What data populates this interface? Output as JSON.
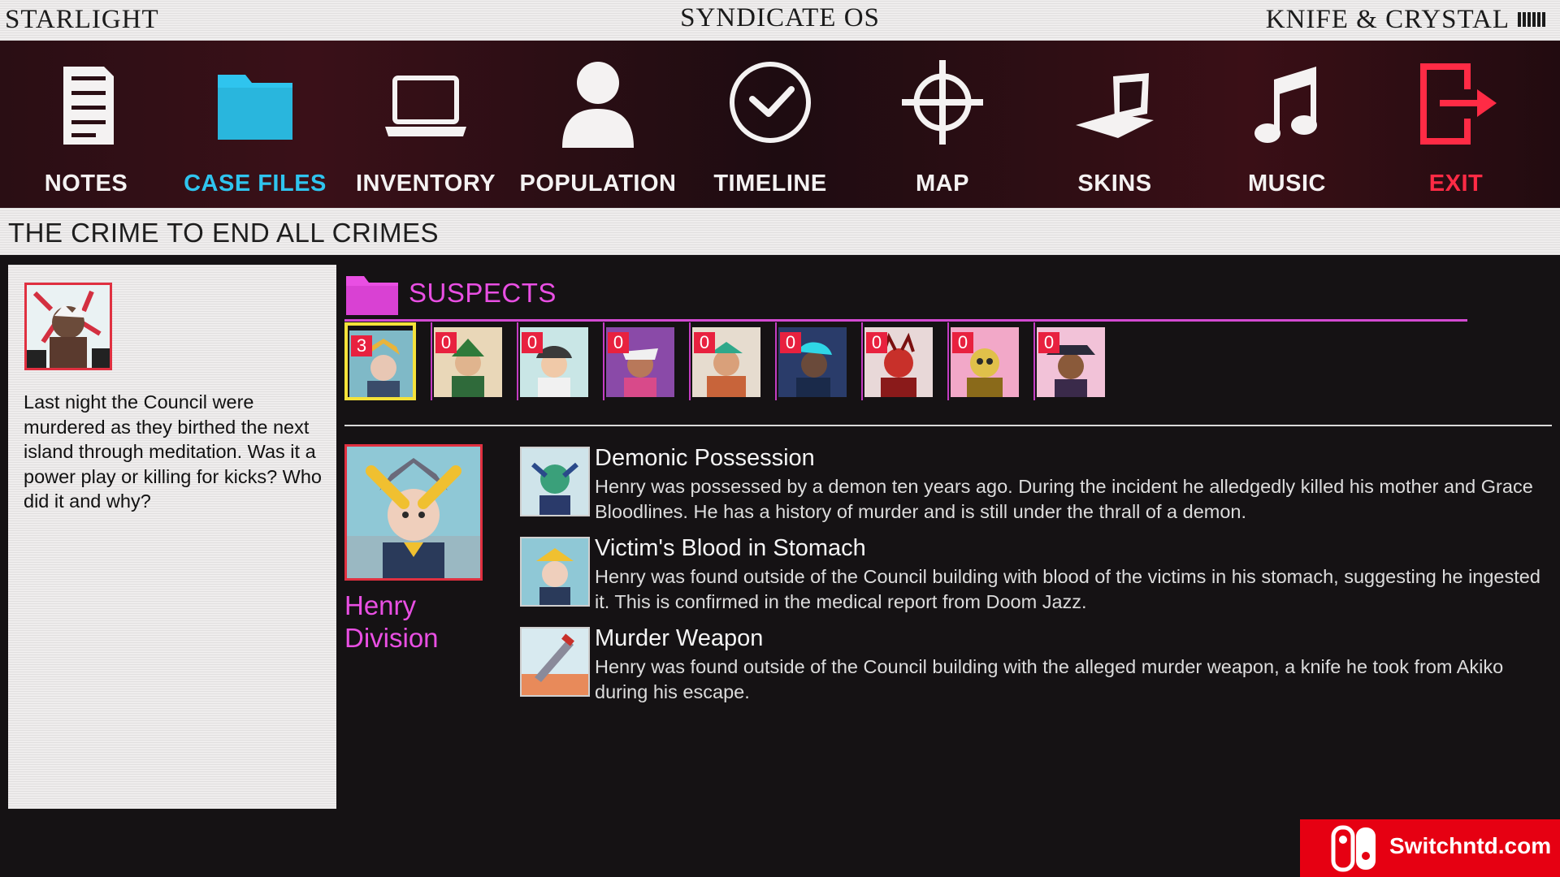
{
  "topbar": {
    "left": "STARLIGHT",
    "center": "SYNDICATE OS",
    "right": "KNIFE & CRYSTAL"
  },
  "nav": {
    "items": [
      {
        "label": "NOTES",
        "icon": "notes-icon"
      },
      {
        "label": "CASE FILES",
        "icon": "folder-icon",
        "active": true
      },
      {
        "label": "INVENTORY",
        "icon": "laptop-icon"
      },
      {
        "label": "POPULATION",
        "icon": "person-icon"
      },
      {
        "label": "TIMELINE",
        "icon": "clock-icon"
      },
      {
        "label": "MAP",
        "icon": "crosshair-icon"
      },
      {
        "label": "SKINS",
        "icon": "skins-icon"
      },
      {
        "label": "MUSIC",
        "icon": "music-note-icon"
      },
      {
        "label": "EXIT",
        "icon": "exit-icon"
      }
    ]
  },
  "case": {
    "title": "THE CRIME TO END ALL CRIMES",
    "summary": "Last night the Council were murdered as they birthed the next island through meditation. Was it a power play or killing for kicks? Who did it and why?"
  },
  "suspects": {
    "label": "SUSPECTS",
    "counts": [
      "3",
      "0",
      "0",
      "0",
      "0",
      "0",
      "0",
      "0",
      "0"
    ],
    "selected_index": 0
  },
  "selected_suspect": {
    "name": "Henry Division",
    "evidence": [
      {
        "title": "Demonic Possession",
        "description": "Henry was possessed by a demon ten years ago. During the incident he alledgedly killed his mother and Grace Bloodlines. He has a history of murder and is still under the thrall of a demon."
      },
      {
        "title": "Victim's Blood in Stomach",
        "description": "Henry was found outside of the Council building with blood of the victims in his stomach, suggesting he ingested it. This is confirmed in the medical report from Doom Jazz."
      },
      {
        "title": "Murder Weapon",
        "description": "Henry was found outside of the Council building with the alleged murder weapon, a knife he took from Akiko during his escape."
      }
    ]
  },
  "watermark": {
    "text": "Switchntd.com"
  },
  "colors": {
    "accent_pink": "#e94fe3",
    "accent_cyan": "#2fc4ee",
    "exit_red": "#ff2b45",
    "badge_red": "#e8213f",
    "selected_yellow": "#f5e23a"
  }
}
